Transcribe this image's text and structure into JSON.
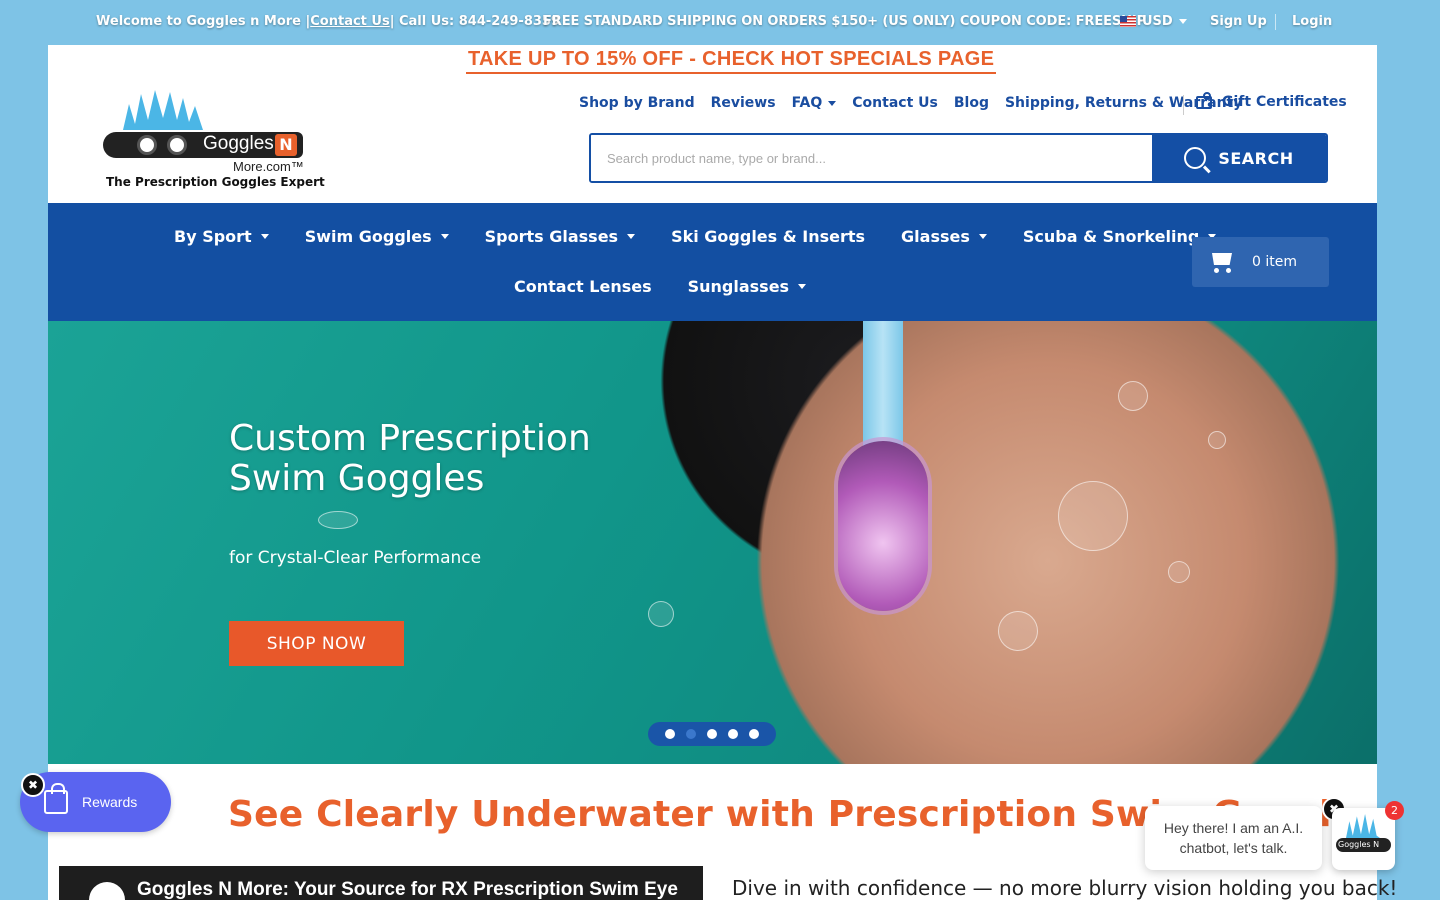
{
  "topbar": {
    "welcome": "Welcome to Goggles n More |",
    "contact_link": "Contact Us",
    "call": "| Call Us: 844-249-8359",
    "shipping": "FREE STANDARD SHIPPING ON ORDERS $150+ (US ONLY) COUPON CODE: FREESHIP",
    "currency": "USD",
    "signup": "Sign Up",
    "login": "Login"
  },
  "promo": "TAKE UP TO 15% OFF - CHECK HOT SPECIALS PAGE",
  "logo": {
    "brand": "Goggles",
    "n": "N",
    "more": "More.com™",
    "tagline": "The Prescription Goggles Expert"
  },
  "header_nav": [
    {
      "label": "Shop by Brand"
    },
    {
      "label": "Reviews"
    },
    {
      "label": "FAQ"
    },
    {
      "label": "Contact Us"
    },
    {
      "label": "Blog"
    },
    {
      "label": "Shipping, Returns & Warranty"
    }
  ],
  "gift": "Gift Certificates",
  "search": {
    "placeholder": "Search product name, type or brand...",
    "button": "SEARCH"
  },
  "main_nav_row1": [
    {
      "label": "By Sport"
    },
    {
      "label": "Swim Goggles"
    },
    {
      "label": "Sports Glasses"
    },
    {
      "label": "Ski Goggles & Inserts"
    },
    {
      "label": "Glasses"
    },
    {
      "label": "Scuba & Snorkeling"
    }
  ],
  "main_nav_row2": [
    {
      "label": "Contact Lenses"
    },
    {
      "label": "Sunglasses"
    }
  ],
  "cart": "0 item",
  "hero": {
    "title": "Custom Prescription Swim Goggles",
    "subtitle": "for Crystal-Clear Performance",
    "cta": "SHOP NOW"
  },
  "content": {
    "headline": "See Clearly Underwater with Prescription Swim Goggl",
    "video_title": "Goggles N More: Your Source for RX Prescription Swim Eye",
    "body": "Dive in with confidence — no more blurry vision holding you back!"
  },
  "rewards": "Rewards",
  "chat": {
    "message": "Hey there! I am an A.I. chatbot, let's talk.",
    "badge": "2",
    "logo_text": "Goggles N"
  },
  "colors": {
    "accent_orange": "#e8612c",
    "brand_blue": "#134fa2",
    "rewards_purple": "#5a64f0"
  }
}
